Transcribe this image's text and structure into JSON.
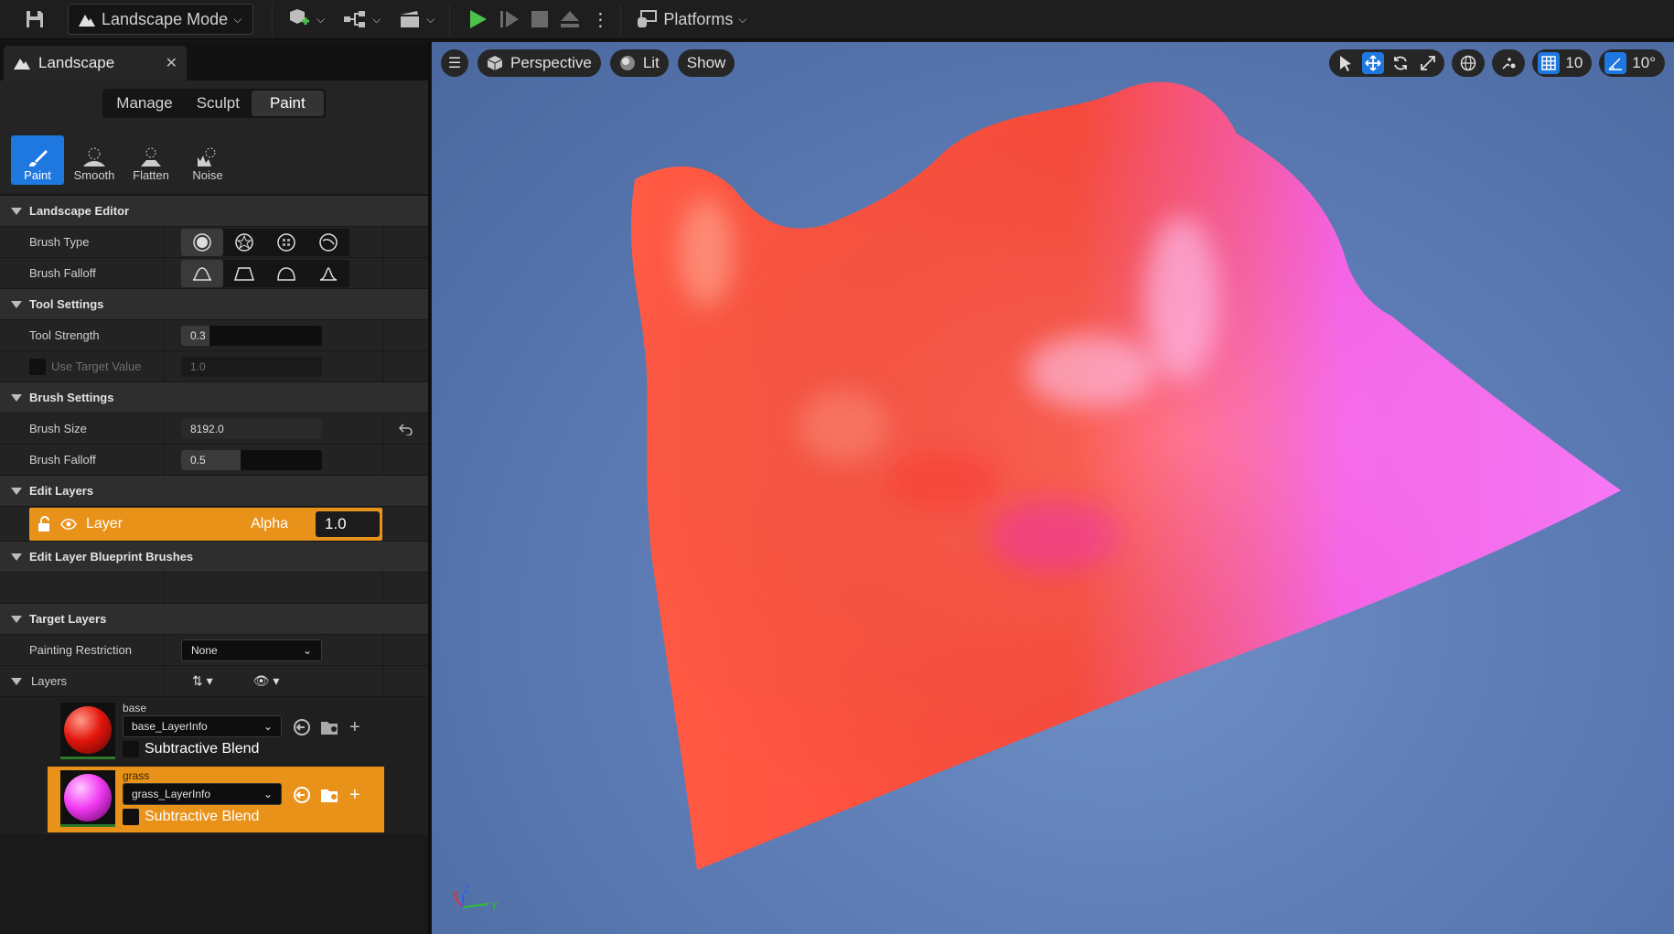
{
  "toolbar": {
    "mode_label": "Landscape Mode",
    "platforms_label": "Platforms"
  },
  "panel": {
    "tab_title": "Landscape",
    "modes": [
      "Manage",
      "Sculpt",
      "Paint"
    ],
    "active_mode": "Paint",
    "tools": [
      {
        "label": "Paint",
        "icon": "brush-icon",
        "active": true
      },
      {
        "label": "Smooth",
        "icon": "smooth-icon",
        "active": false
      },
      {
        "label": "Flatten",
        "icon": "flatten-icon",
        "active": false
      },
      {
        "label": "Noise",
        "icon": "noise-icon",
        "active": false
      }
    ]
  },
  "sections": {
    "landscape_editor": "Landscape Editor",
    "tool_settings": "Tool Settings",
    "brush_settings": "Brush Settings",
    "edit_layers": "Edit Layers",
    "blueprint_brushes": "Edit Layer Blueprint Brushes",
    "target_layers": "Target Layers"
  },
  "props": {
    "brush_type": "Brush Type",
    "brush_falloff_shape": "Brush Falloff",
    "tool_strength": "Tool Strength",
    "tool_strength_value": "0.3",
    "tool_strength_fraction": 0.2,
    "use_target_value": "Use Target Value",
    "target_value": "1.0",
    "brush_size": "Brush Size",
    "brush_size_value": "8192.0",
    "brush_falloff": "Brush Falloff",
    "brush_falloff_value": "0.5",
    "brush_falloff_fraction": 0.42,
    "painting_restriction": "Painting Restriction",
    "painting_restriction_value": "None",
    "layers": "Layers"
  },
  "edit_layer": {
    "name": "Layer",
    "alpha_label": "Alpha",
    "alpha_value": "1.0",
    "accent": "#e8921a"
  },
  "target_layers": [
    {
      "name": "base",
      "info": "base_LayerInfo",
      "blend": "Subtractive Blend",
      "color": "#ff2a1a",
      "selected": false
    },
    {
      "name": "grass",
      "info": "grass_LayerInfo",
      "blend": "Subtractive Blend",
      "color": "#ff3aff",
      "selected": true
    }
  ],
  "viewport": {
    "view_label": "Perspective",
    "lit_label": "Lit",
    "show_label": "Show",
    "grid_snap": "10",
    "angle_snap": "10°"
  }
}
